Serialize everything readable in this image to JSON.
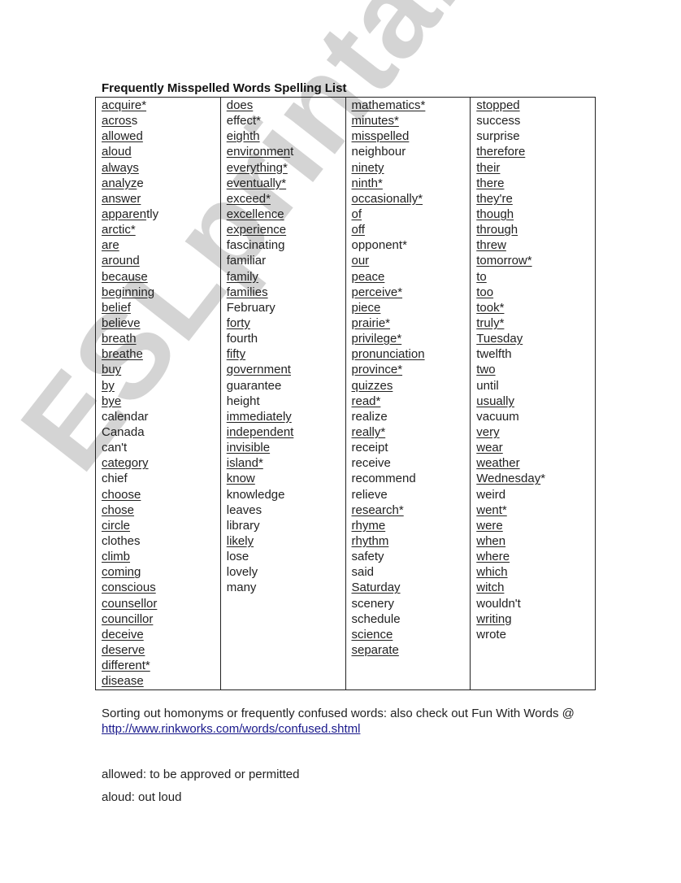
{
  "title": "Frequently Misspelled Words Spelling List",
  "columns": [
    [
      {
        "w": "acquire*",
        "u": 8
      },
      {
        "w": "across",
        "u": 5
      },
      {
        "w": "allowed",
        "u": 7
      },
      {
        "w": "aloud",
        "u": 5
      },
      {
        "w": "always",
        "u": 6
      },
      {
        "w": "analyze",
        "u": 6
      },
      {
        "w": "answer",
        "u": 6
      },
      {
        "w": "apparently",
        "u": 7
      },
      {
        "w": "arctic*",
        "u": 7
      },
      {
        "w": "are",
        "u": 3
      },
      {
        "w": "around",
        "u": 6
      },
      {
        "w": "because",
        "u": 7
      },
      {
        "w": "beginning",
        "u": 9
      },
      {
        "w": "belief",
        "u": 6
      },
      {
        "w": "believe",
        "u": 7
      },
      {
        "w": "breath",
        "u": 6
      },
      {
        "w": "breathe",
        "u": 7
      },
      {
        "w": "buy",
        "u": 3
      },
      {
        "w": "by",
        "u": 2
      },
      {
        "w": "bye",
        "u": 3
      },
      {
        "w": "calendar",
        "u": 0
      },
      {
        "w": "Canada",
        "u": 0
      },
      {
        "w": "can't",
        "u": 0
      },
      {
        "w": "category",
        "u": 8
      },
      {
        "w": "chief",
        "u": 0
      },
      {
        "w": "choose",
        "u": 6
      },
      {
        "w": "chose",
        "u": 5
      },
      {
        "w": "circle",
        "u": 6
      },
      {
        "w": "clothes",
        "u": 0
      },
      {
        "w": "climb",
        "u": 5
      },
      {
        "w": "coming",
        "u": 6
      },
      {
        "w": "conscious",
        "u": 9
      },
      {
        "w": "counsellor",
        "u": 10
      },
      {
        "w": "councillor",
        "u": 10
      },
      {
        "w": "deceive",
        "u": 7
      },
      {
        "w": "deserve",
        "u": 7
      },
      {
        "w": "different*",
        "u": 10
      },
      {
        "w": "disease",
        "u": 7
      }
    ],
    [
      {
        "w": "does",
        "u": 4
      },
      {
        "w": "effect*",
        "u": 0
      },
      {
        "w": "eighth",
        "u": 6
      },
      {
        "w": "environment",
        "u": 10
      },
      {
        "w": "everything*",
        "u": 11
      },
      {
        "w": "eventually*",
        "u": 11
      },
      {
        "w": "exceed*",
        "u": 7
      },
      {
        "w": "excellence",
        "u": 10
      },
      {
        "w": "experience",
        "u": 10
      },
      {
        "w": "fascinating",
        "u": 0
      },
      {
        "w": "familiar",
        "u": 0
      },
      {
        "w": "family",
        "u": 6
      },
      {
        "w": "families",
        "u": 8
      },
      {
        "w": "February",
        "u": 0
      },
      {
        "w": "forty",
        "u": 5
      },
      {
        "w": "fourth",
        "u": 0
      },
      {
        "w": "fifty",
        "u": 5
      },
      {
        "w": "government",
        "u": 10
      },
      {
        "w": "guarantee",
        "u": 0
      },
      {
        "w": "height",
        "u": 0
      },
      {
        "w": "immediately",
        "u": 11
      },
      {
        "w": "independent",
        "u": 11
      },
      {
        "w": "invisible",
        "u": 9
      },
      {
        "w": "island*",
        "u": 7
      },
      {
        "w": "know",
        "u": 4
      },
      {
        "w": "knowledge",
        "u": 0
      },
      {
        "w": "leaves",
        "u": 0
      },
      {
        "w": "library",
        "u": 0
      },
      {
        "w": "likely",
        "u": 6
      },
      {
        "w": "lose",
        "u": 0
      },
      {
        "w": "lovely",
        "u": 0
      },
      {
        "w": "many",
        "u": 0
      }
    ],
    [
      {
        "w": "mathematics*",
        "u": 12
      },
      {
        "w": "minutes*",
        "u": 8
      },
      {
        "w": "misspelled",
        "u": 10
      },
      {
        "w": "neighbour",
        "u": 0
      },
      {
        "w": "ninety",
        "u": 6
      },
      {
        "w": "ninth*",
        "u": 6
      },
      {
        "w": "occasionally*",
        "u": 13
      },
      {
        "w": "of",
        "u": 2
      },
      {
        "w": "off",
        "u": 3
      },
      {
        "w": "opponent*",
        "u": 0
      },
      {
        "w": "our",
        "u": 3
      },
      {
        "w": "peace",
        "u": 5
      },
      {
        "w": "perceive*",
        "u": 9
      },
      {
        "w": "piece",
        "u": 5
      },
      {
        "w": "prairie*",
        "u": 8
      },
      {
        "w": "privilege*",
        "u": 10
      },
      {
        "w": "pronunciation",
        "u": 13
      },
      {
        "w": "province*",
        "u": 9
      },
      {
        "w": "quizzes",
        "u": 7
      },
      {
        "w": "read*",
        "u": 5
      },
      {
        "w": "realize",
        "u": 0
      },
      {
        "w": "really*",
        "u": 7
      },
      {
        "w": "receipt",
        "u": 0
      },
      {
        "w": "receive",
        "u": 0
      },
      {
        "w": "recommend",
        "u": 0
      },
      {
        "w": "relieve",
        "u": 0
      },
      {
        "w": "research*",
        "u": 9
      },
      {
        "w": "rhyme",
        "u": 5
      },
      {
        "w": "rhythm",
        "u": 6
      },
      {
        "w": "safety",
        "u": 0
      },
      {
        "w": "said",
        "u": 0
      },
      {
        "w": "Saturday",
        "u": 8
      },
      {
        "w": "scenery",
        "u": 0
      },
      {
        "w": "schedule",
        "u": 0
      },
      {
        "w": "science",
        "u": 7
      },
      {
        "w": "separate",
        "u": 8
      }
    ],
    [
      {
        "w": "stopped",
        "u": 7
      },
      {
        "w": "success",
        "u": 0
      },
      {
        "w": "surprise",
        "u": 0
      },
      {
        "w": "therefore",
        "u": 9
      },
      {
        "w": "their",
        "u": 5
      },
      {
        "w": "there",
        "u": 5
      },
      {
        "w": "they're",
        "u": 7
      },
      {
        "w": "though",
        "u": 6
      },
      {
        "w": "through",
        "u": 7
      },
      {
        "w": "threw",
        "u": 5
      },
      {
        "w": "tomorrow*",
        "u": 9
      },
      {
        "w": "to",
        "u": 2
      },
      {
        "w": "too",
        "u": 3
      },
      {
        "w": "took*",
        "u": 5
      },
      {
        "w": "truly*",
        "u": 6
      },
      {
        "w": "Tuesday",
        "u": 7
      },
      {
        "w": "twelfth",
        "u": 0
      },
      {
        "w": "two",
        "u": 3
      },
      {
        "w": "until",
        "u": 0
      },
      {
        "w": "usually",
        "u": 7
      },
      {
        "w": "vacuum",
        "u": 0
      },
      {
        "w": "very",
        "u": 4
      },
      {
        "w": "wear",
        "u": 4
      },
      {
        "w": "weather",
        "u": 7
      },
      {
        "w": "Wednesday*",
        "u": 9
      },
      {
        "w": "weird",
        "u": 0
      },
      {
        "w": "went*",
        "u": 5
      },
      {
        "w": "were",
        "u": 4
      },
      {
        "w": "when",
        "u": 4
      },
      {
        "w": "where",
        "u": 5
      },
      {
        "w": "which",
        "u": 5
      },
      {
        "w": "witch",
        "u": 5
      },
      {
        "w": "wouldn't",
        "u": 0
      },
      {
        "w": "writing",
        "u": 7
      },
      {
        "w": "wrote",
        "u": 0
      }
    ]
  ],
  "footer": {
    "text": "Sorting out homonyms or frequently confused words: also check out Fun With Words @ ",
    "link": "http://www.rinkworks.com/words/confused.shtml"
  },
  "definitions": [
    "allowed: to be approved or permitted",
    "aloud: out loud"
  ],
  "watermark": "ESLprintables.com"
}
